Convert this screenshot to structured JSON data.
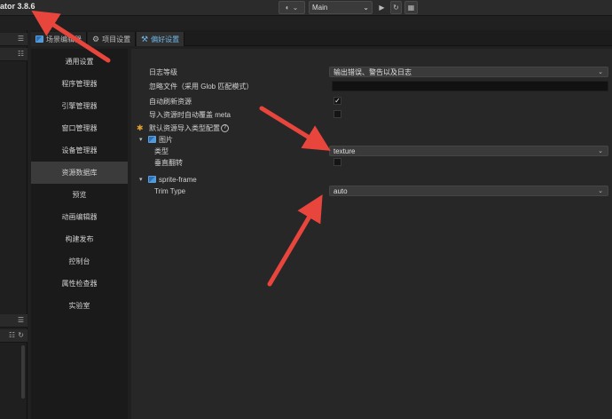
{
  "app": {
    "title": "ator 3.8.6"
  },
  "toolbar": {
    "scene_value": "Main",
    "play_glyph": "▶",
    "refresh_glyph": "↻",
    "qr_glyph": "▦",
    "globe_glyph": "◐",
    "chevron_glyph": "⌄"
  },
  "tabs": [
    {
      "label": "场景编辑器"
    },
    {
      "label": "项目设置"
    },
    {
      "label": "偏好设置"
    }
  ],
  "categories": [
    {
      "label": "通用设置"
    },
    {
      "label": "程序管理器"
    },
    {
      "label": "引擎管理器"
    },
    {
      "label": "窗口管理器"
    },
    {
      "label": "设备管理器"
    },
    {
      "label": "资源数据库"
    },
    {
      "label": "预览"
    },
    {
      "label": "动画编辑器"
    },
    {
      "label": "构建发布"
    },
    {
      "label": "控制台"
    },
    {
      "label": "属性检查器"
    },
    {
      "label": "实验室"
    }
  ],
  "settings": {
    "log_level": {
      "label": "日志等级",
      "value": "输出错误、警告以及日志"
    },
    "ignore_files": {
      "label": "忽略文件（采用 Glob 匹配模式）",
      "value": ""
    },
    "auto_refresh": {
      "label": "自动刷新资源",
      "checked": true,
      "check_glyph": "✓"
    },
    "auto_overwrite_meta": {
      "label": "导入资源时自动覆盖 meta",
      "checked": false
    },
    "default_import_config": {
      "label": "默认资源导入类型配置",
      "help_glyph": "?"
    },
    "image": {
      "group_label": "图片",
      "type_label": "类型",
      "type_value": "texture",
      "flip_label": "垂直翻转",
      "flip_checked": false
    },
    "sprite_frame": {
      "group_label": "sprite-frame",
      "trim_label": "Trim Type",
      "trim_value": "auto"
    }
  }
}
